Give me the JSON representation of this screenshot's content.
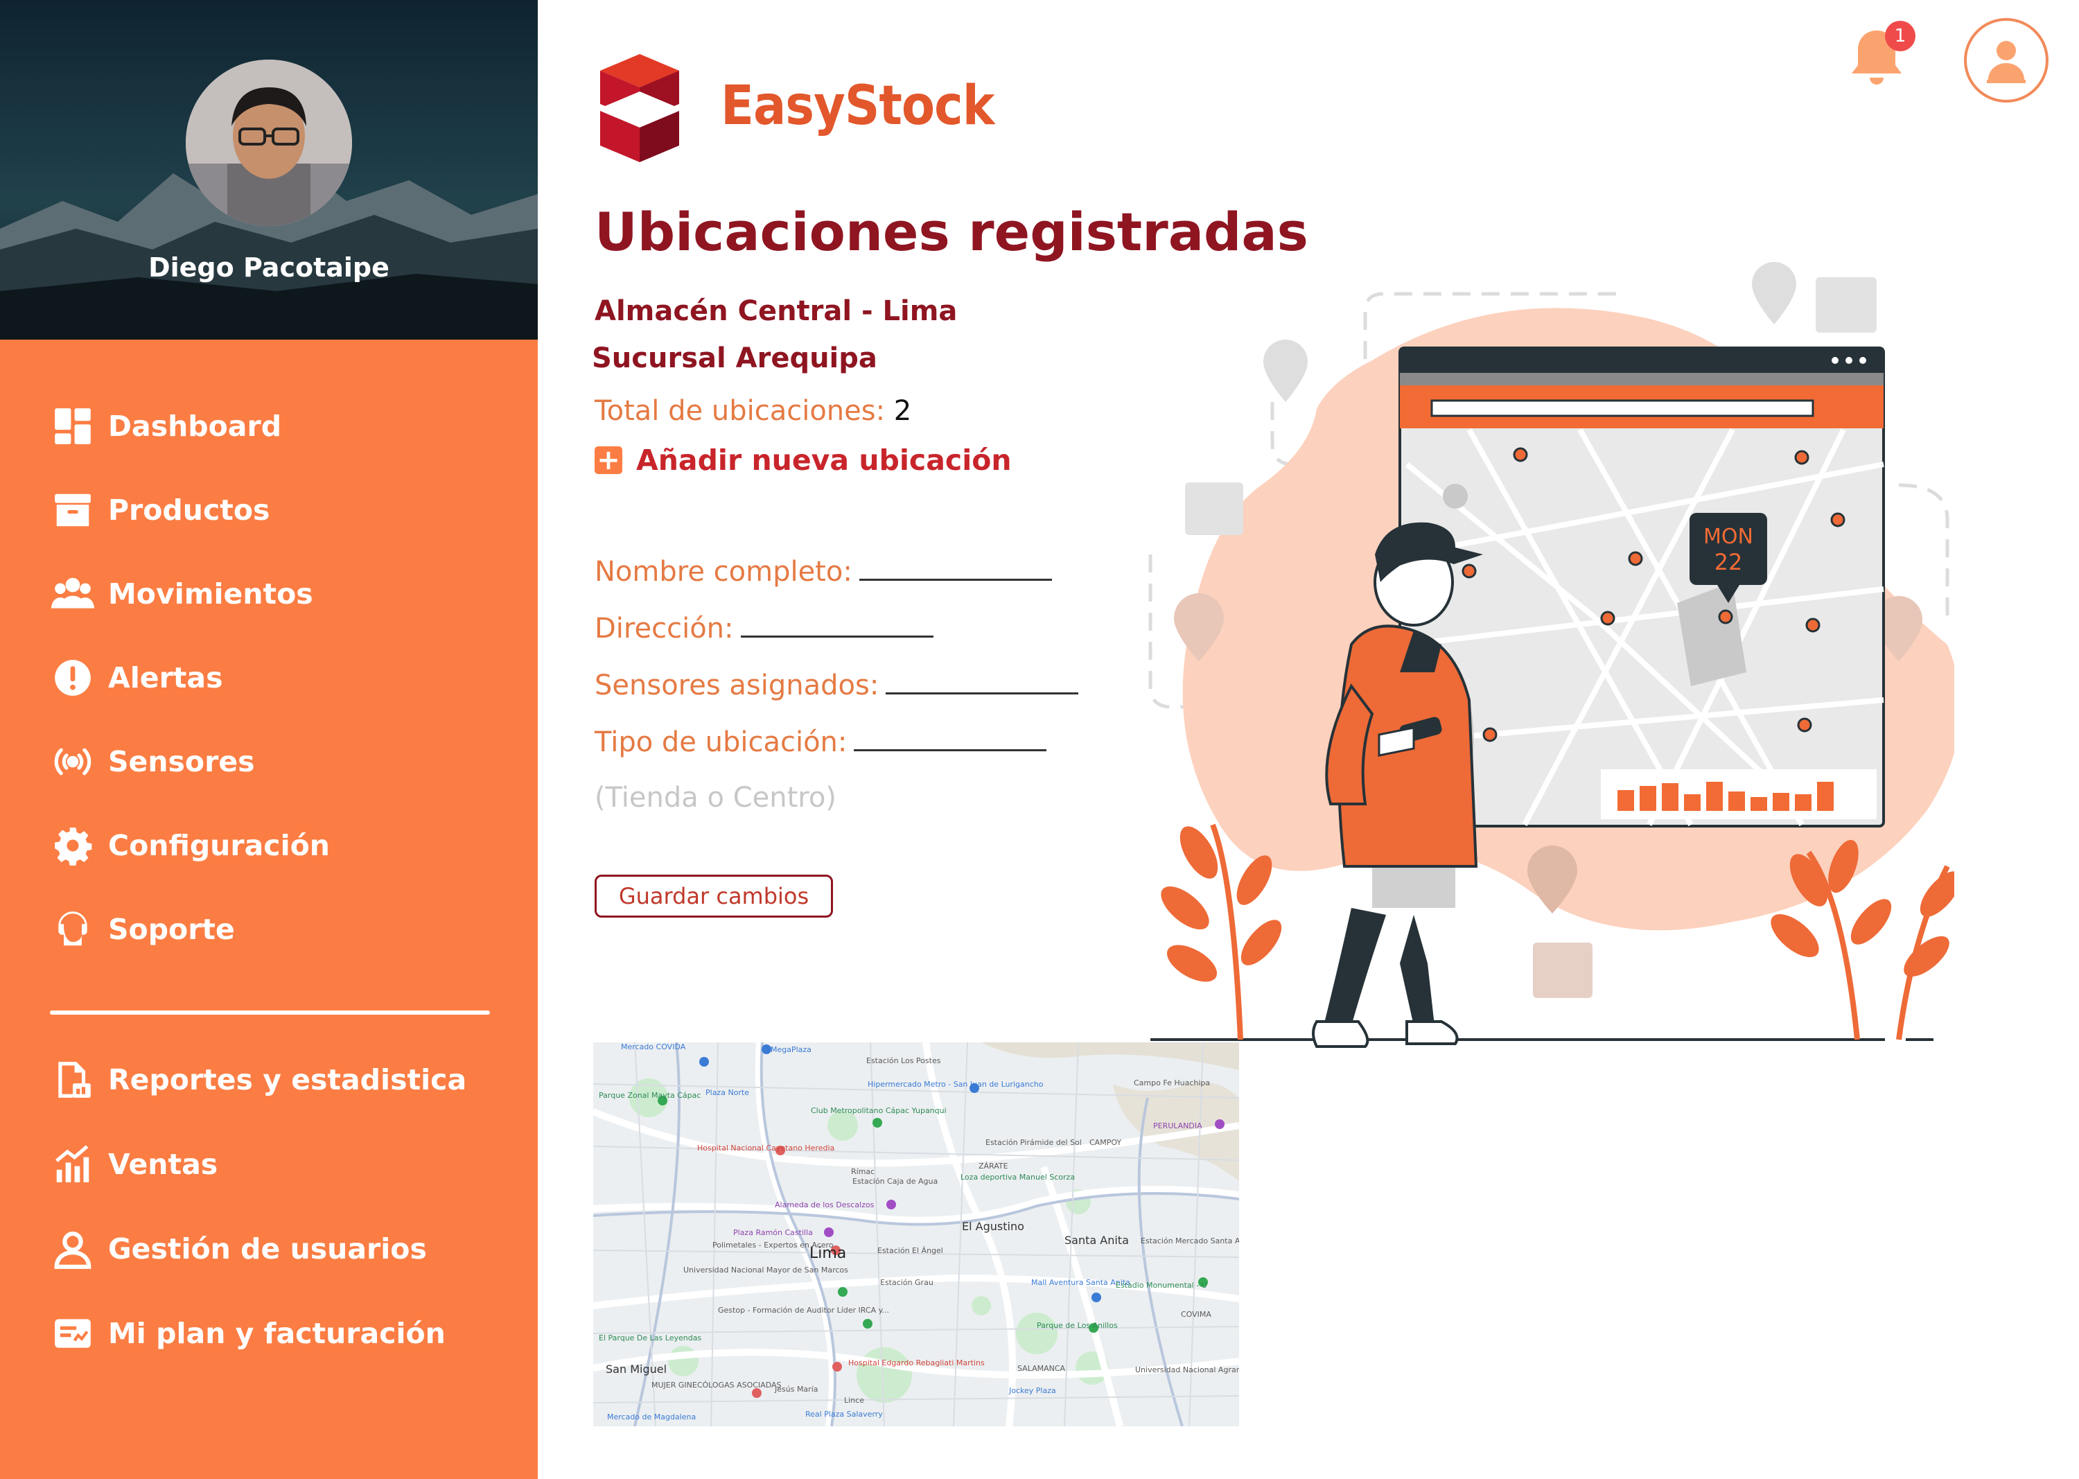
{
  "sidebar": {
    "user_name": "Diego Pacotaipe",
    "items": [
      {
        "label": "Dashboard",
        "icon": "dashboard-icon"
      },
      {
        "label": "Productos",
        "icon": "archive-icon"
      },
      {
        "label": "Movimientos",
        "icon": "users-group-icon"
      },
      {
        "label": "Alertas",
        "icon": "alert-icon"
      },
      {
        "label": "Sensores",
        "icon": "broadcast-icon"
      },
      {
        "label": "Configuración",
        "icon": "gear-icon"
      },
      {
        "label": "Soporte",
        "icon": "headset-icon"
      },
      {
        "label": "Reportes y estadistica",
        "icon": "report-icon"
      },
      {
        "label": "Ventas",
        "icon": "chart-bars-icon"
      },
      {
        "label": "Gestión de usuarios",
        "icon": "user-icon"
      },
      {
        "label": "Mi plan y facturación",
        "icon": "billing-icon"
      }
    ]
  },
  "header": {
    "brand": "EasyStock",
    "notification_count": "1"
  },
  "main": {
    "title": "Ubicaciones registradas",
    "locations": [
      "Almacén Central - Lima",
      "Sucursal Arequipa"
    ],
    "total_label": "Total de ubicaciones:",
    "total_value": "2",
    "add_label": "Añadir nueva ubicación",
    "fields": [
      {
        "label": "Nombre completo:"
      },
      {
        "label": "Dirección:"
      },
      {
        "label": "Sensores asignados:"
      },
      {
        "label": "Tipo de ubicación:"
      }
    ],
    "type_hint": "(Tienda o Centro)",
    "save_label": "Guardar cambios"
  },
  "illustration": {
    "calendar_day": "MON",
    "calendar_date": "22"
  },
  "map": {
    "labels": {
      "lima": "Lima",
      "el_agustino": "El Agustino",
      "santa_anita": "Santa Anita",
      "san_miguel": "San Miguel",
      "rimac": "Rímac",
      "zarate": "ZÁRATE",
      "campoy": "CAMPOY",
      "covima": "COVIMA",
      "salamanca": "SALAMANCA",
      "lince": "Lince",
      "jesus_maria": "Jesús María",
      "hospital_cayetano": "Hospital Nacional Cayetano Heredia",
      "hospital_rebagliati": "Hospital Edgardo Rebagliati Martins",
      "alameda": "Alameda de los Descalzos",
      "plaza_castilla": "Plaza Ramón Castilla",
      "estacion_grau": "Estación Grau",
      "plaza_norte": "Plaza Norte",
      "mega_plaza": "MegaPlaza",
      "mercado_covida": "Mercado COVIDA",
      "parque_zonal": "Parque Zonal Mayta Cápac",
      "campo_fe": "Campo Fe Huachipa",
      "perulandia": "PERULANDIA",
      "univ_agraria": "Universidad Nacional Agraria La Molina",
      "univ_san_marcos": "Universidad Nacional Mayor de San Marcos",
      "real_plaza_salaverry": "Real Plaza Salaverry",
      "mercado_magdalena": "Mercado de Magdalena",
      "estacion_los_postes": "Estación Los Postes",
      "hipermercado_metro": "Hipermercado Metro - San Juan de Lurigancho",
      "club_metropolitano": "Club Metropolitano Cápac Yupanqui",
      "estacion_piramide": "Estación Pirámide del Sol",
      "estacion_caja_agua": "Estación Caja de Agua",
      "loza_deportiva": "Loza deportiva Manuel Scorza",
      "polimetales": "Polimetales - Expertos en Acero",
      "estacion_el_angel": "Estación El Ángel",
      "mall_aventura": "Mall Aventura Santa Anita",
      "estadio_monumental": "Estadio Monumental - U",
      "estacion_mercado_santa_anita": "Estación Mercado Santa Anita",
      "parque_anillos": "Parque de Los Anillos",
      "gestion_formacion": "Gestop - Formación de Auditor Líder IRCA y...",
      "parque_leyendas": "El Parque De Las Leyendas",
      "mujer_ginecologas": "MUJER GINECÓLOGAS ASOCIADAS",
      "jockey_plaza": "Jockey Plaza"
    }
  },
  "colors": {
    "sidebar": "#fb7d43",
    "title": "#8f1521",
    "accent": "#e57a43",
    "brand": "#e2572b"
  }
}
